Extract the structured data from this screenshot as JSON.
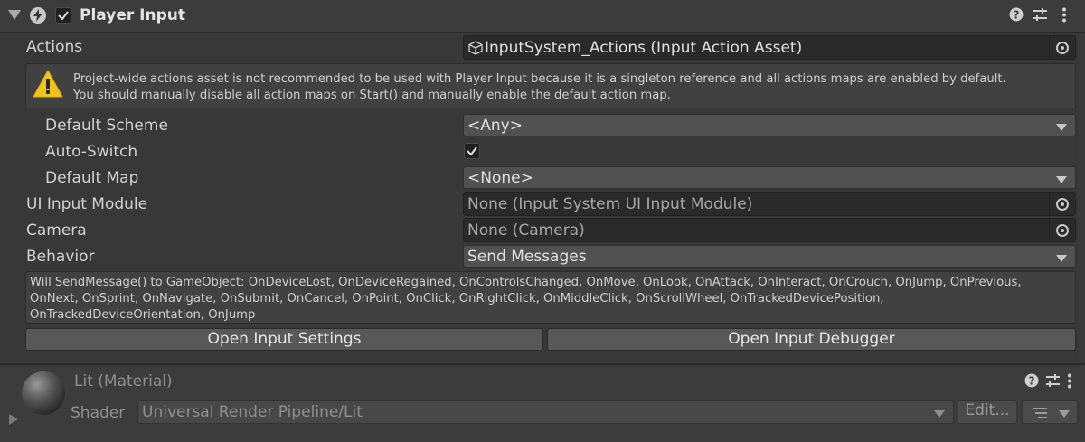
{
  "header": {
    "title": "Player Input",
    "enabled": true,
    "icons": [
      "help-icon",
      "preset-icon",
      "more-icon"
    ]
  },
  "actions": {
    "label": "Actions",
    "value": "InputSystem_Actions (Input Action Asset)"
  },
  "warning": {
    "line1": "Project-wide actions asset is not recommended to be used with Player Input because it is a singleton reference and all actions maps are enabled by default.",
    "line2": "You should manually disable all action maps on Start() and manually enable the default action map."
  },
  "default_scheme": {
    "label": "Default Scheme",
    "value": "<Any>"
  },
  "auto_switch": {
    "label": "Auto-Switch",
    "checked": true
  },
  "default_map": {
    "label": "Default Map",
    "value": "<None>"
  },
  "ui_input_module": {
    "label": "UI Input Module",
    "value": "None (Input System UI Input Module)"
  },
  "camera": {
    "label": "Camera",
    "value": "None (Camera)"
  },
  "behavior": {
    "label": "Behavior",
    "value": "Send Messages"
  },
  "info": {
    "line1": "Will SendMessage() to GameObject: OnDeviceLost, OnDeviceRegained, OnControlsChanged, OnMove, OnLook, OnAttack, OnInteract, OnCrouch, OnJump, OnPrevious,",
    "line2": "OnNext, OnSprint, OnNavigate, OnSubmit, OnCancel, OnPoint, OnClick, OnRightClick, OnMiddleClick, OnScrollWheel, OnTrackedDevicePosition,",
    "line3": "OnTrackedDeviceOrientation, OnJump"
  },
  "buttons": {
    "open_settings": "Open Input Settings",
    "open_debugger": "Open Input Debugger"
  },
  "material": {
    "title": "Lit (Material)",
    "shader_label": "Shader",
    "shader_value": "Universal Render Pipeline/Lit",
    "edit_label": "Edit..."
  }
}
